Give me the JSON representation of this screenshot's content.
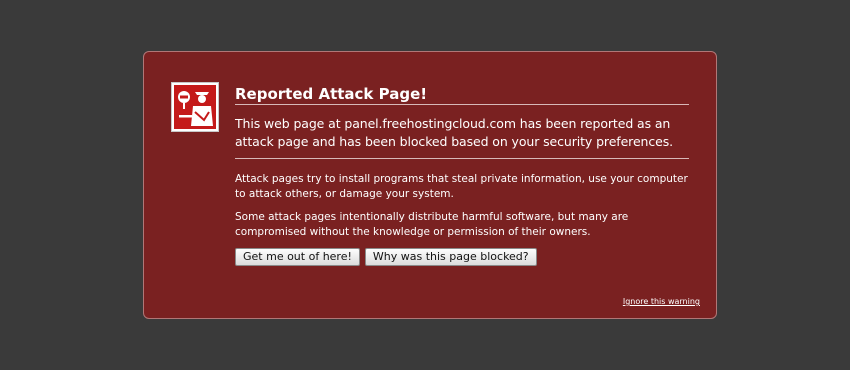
{
  "error": {
    "title": "Reported Attack Page!",
    "short_desc": "This web page at panel.freehostingcloud.com has been reported as an attack page and has been blocked based on your security preferences.",
    "long_desc": [
      "Attack pages try to install programs that steal private information, use your computer to attack others, or damage your system.",
      "Some attack pages intentionally distribute harmful software, but many are compromised without the knowledge or permission of their owners."
    ],
    "buttons": {
      "get_me_out": "Get me out of here!",
      "why_blocked": "Why was this page blocked?"
    },
    "ignore_link": "Ignore this warning"
  },
  "icons": {
    "shield": "security-officer-icon"
  },
  "colors": {
    "background": "#3a3a3a",
    "panel": "#7a2121",
    "text": "#ffffff"
  }
}
